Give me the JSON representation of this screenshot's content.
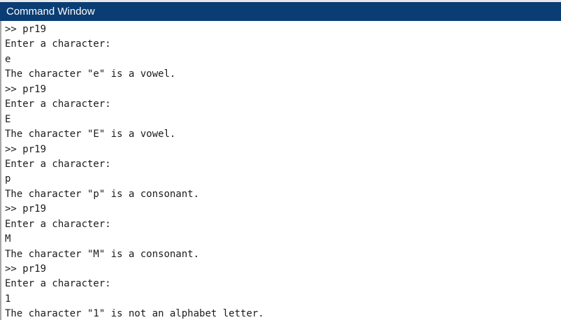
{
  "window": {
    "title": "Command Window"
  },
  "console": {
    "lines": [
      ">> pr19",
      "Enter a character:",
      "e",
      "The character \"e\" is a vowel.",
      ">> pr19",
      "Enter a character:",
      "E",
      "The character \"E\" is a vowel.",
      ">> pr19",
      "Enter a character:",
      "p",
      "The character \"p\" is a consonant.",
      ">> pr19",
      "Enter a character:",
      "M",
      "The character \"M\" is a consonant.",
      ">> pr19",
      "Enter a character:",
      "1",
      "The character \"1\" is not an alphabet letter."
    ]
  },
  "colors": {
    "titlebar_bg": "#0a3d73",
    "titlebar_text": "#ffffff",
    "console_text": "#1a1a1a",
    "console_bg": "#ffffff"
  }
}
